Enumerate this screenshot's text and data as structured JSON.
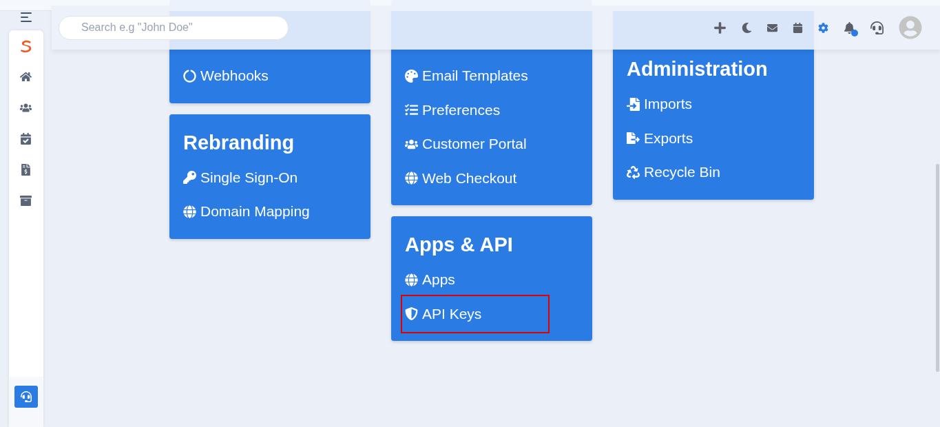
{
  "header": {
    "search": {
      "placeholder": "Search e.g \"John Doe\""
    }
  },
  "columns": [
    {
      "cards": [
        {
          "items": [
            {
              "label": "Webhooks",
              "highlighted": false
            }
          ]
        },
        {
          "title": "Rebranding",
          "items": [
            {
              "label": "Single Sign-On",
              "highlighted": false
            },
            {
              "label": "Domain Mapping",
              "highlighted": false
            }
          ]
        }
      ]
    },
    {
      "cards": [
        {
          "items": [
            {
              "label": "Email Templates",
              "highlighted": false
            },
            {
              "label": "Preferences",
              "highlighted": false
            },
            {
              "label": "Customer Portal",
              "highlighted": false
            },
            {
              "label": "Web Checkout",
              "highlighted": false
            }
          ]
        },
        {
          "title": "Apps & API",
          "items": [
            {
              "label": "Apps",
              "highlighted": false
            },
            {
              "label": "API Keys",
              "highlighted": true
            }
          ]
        }
      ]
    },
    {
      "cards": [
        {
          "title": "Administration",
          "items": [
            {
              "label": "Imports",
              "highlighted": false
            },
            {
              "label": "Exports",
              "highlighted": false
            },
            {
              "label": "Recycle Bin",
              "highlighted": false
            }
          ]
        }
      ]
    }
  ]
}
